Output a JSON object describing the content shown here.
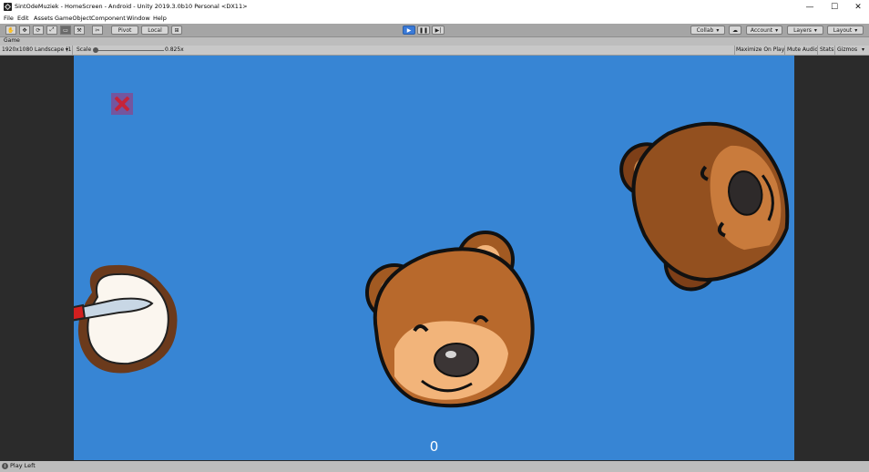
{
  "window": {
    "title": "SintOdeMuziek - HomeScreen - Android - Unity 2019.3.0b10 Personal <DX11>",
    "minimize_glyph": "—",
    "maximize_glyph": "☐",
    "close_glyph": "✕"
  },
  "menu": [
    "File",
    "Edit",
    "Assets",
    "GameObject",
    "Component",
    "Window",
    "Help"
  ],
  "toolbar": {
    "tool_glyphs": [
      "✋",
      "✥",
      "⟳",
      "⤢",
      "▭",
      "⚒"
    ],
    "pivot_label": "Pivot",
    "local_label": "Local",
    "play_glyph": "▶",
    "pause_glyph": "❚❚",
    "step_glyph": "▶|",
    "collab_label": "Collab",
    "cloud_glyph": "☁",
    "account_label": "Account",
    "layers_label": "Layers",
    "layout_label": "Layout"
  },
  "game_view": {
    "tab_label": "Game",
    "resolution": "1920x1080 Landscape (1",
    "scale_label": "Scale",
    "scale_value": "0.825x",
    "maximize_on_play": "Maximize On Play",
    "mute_audio": "Mute Audio",
    "stats": "Stats",
    "gizmos": "Gizmos",
    "score": "0"
  },
  "statusbar": {
    "info_glyph": "i",
    "message": "Play Left"
  },
  "colors": {
    "game_background": "#3785d4",
    "play_active": "#3a7ad8",
    "close_x": "#e0141e"
  }
}
